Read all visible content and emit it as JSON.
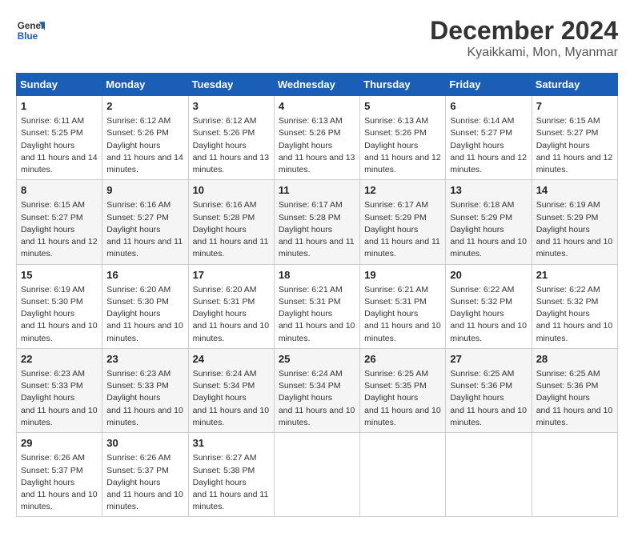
{
  "header": {
    "logo_general": "General",
    "logo_blue": "Blue",
    "month_title": "December 2024",
    "location": "Kyaikkami, Mon, Myanmar"
  },
  "calendar": {
    "days_of_week": [
      "Sunday",
      "Monday",
      "Tuesday",
      "Wednesday",
      "Thursday",
      "Friday",
      "Saturday"
    ],
    "weeks": [
      [
        {
          "day": "1",
          "sunrise": "6:11 AM",
          "sunset": "5:25 PM",
          "daylight": "11 hours and 14 minutes."
        },
        {
          "day": "2",
          "sunrise": "6:12 AM",
          "sunset": "5:26 PM",
          "daylight": "11 hours and 14 minutes."
        },
        {
          "day": "3",
          "sunrise": "6:12 AM",
          "sunset": "5:26 PM",
          "daylight": "11 hours and 13 minutes."
        },
        {
          "day": "4",
          "sunrise": "6:13 AM",
          "sunset": "5:26 PM",
          "daylight": "11 hours and 13 minutes."
        },
        {
          "day": "5",
          "sunrise": "6:13 AM",
          "sunset": "5:26 PM",
          "daylight": "11 hours and 12 minutes."
        },
        {
          "day": "6",
          "sunrise": "6:14 AM",
          "sunset": "5:27 PM",
          "daylight": "11 hours and 12 minutes."
        },
        {
          "day": "7",
          "sunrise": "6:15 AM",
          "sunset": "5:27 PM",
          "daylight": "11 hours and 12 minutes."
        }
      ],
      [
        {
          "day": "8",
          "sunrise": "6:15 AM",
          "sunset": "5:27 PM",
          "daylight": "11 hours and 12 minutes."
        },
        {
          "day": "9",
          "sunrise": "6:16 AM",
          "sunset": "5:27 PM",
          "daylight": "11 hours and 11 minutes."
        },
        {
          "day": "10",
          "sunrise": "6:16 AM",
          "sunset": "5:28 PM",
          "daylight": "11 hours and 11 minutes."
        },
        {
          "day": "11",
          "sunrise": "6:17 AM",
          "sunset": "5:28 PM",
          "daylight": "11 hours and 11 minutes."
        },
        {
          "day": "12",
          "sunrise": "6:17 AM",
          "sunset": "5:29 PM",
          "daylight": "11 hours and 11 minutes."
        },
        {
          "day": "13",
          "sunrise": "6:18 AM",
          "sunset": "5:29 PM",
          "daylight": "11 hours and 10 minutes."
        },
        {
          "day": "14",
          "sunrise": "6:19 AM",
          "sunset": "5:29 PM",
          "daylight": "11 hours and 10 minutes."
        }
      ],
      [
        {
          "day": "15",
          "sunrise": "6:19 AM",
          "sunset": "5:30 PM",
          "daylight": "11 hours and 10 minutes."
        },
        {
          "day": "16",
          "sunrise": "6:20 AM",
          "sunset": "5:30 PM",
          "daylight": "11 hours and 10 minutes."
        },
        {
          "day": "17",
          "sunrise": "6:20 AM",
          "sunset": "5:31 PM",
          "daylight": "11 hours and 10 minutes."
        },
        {
          "day": "18",
          "sunrise": "6:21 AM",
          "sunset": "5:31 PM",
          "daylight": "11 hours and 10 minutes."
        },
        {
          "day": "19",
          "sunrise": "6:21 AM",
          "sunset": "5:31 PM",
          "daylight": "11 hours and 10 minutes."
        },
        {
          "day": "20",
          "sunrise": "6:22 AM",
          "sunset": "5:32 PM",
          "daylight": "11 hours and 10 minutes."
        },
        {
          "day": "21",
          "sunrise": "6:22 AM",
          "sunset": "5:32 PM",
          "daylight": "11 hours and 10 minutes."
        }
      ],
      [
        {
          "day": "22",
          "sunrise": "6:23 AM",
          "sunset": "5:33 PM",
          "daylight": "11 hours and 10 minutes."
        },
        {
          "day": "23",
          "sunrise": "6:23 AM",
          "sunset": "5:33 PM",
          "daylight": "11 hours and 10 minutes."
        },
        {
          "day": "24",
          "sunrise": "6:24 AM",
          "sunset": "5:34 PM",
          "daylight": "11 hours and 10 minutes."
        },
        {
          "day": "25",
          "sunrise": "6:24 AM",
          "sunset": "5:34 PM",
          "daylight": "11 hours and 10 minutes."
        },
        {
          "day": "26",
          "sunrise": "6:25 AM",
          "sunset": "5:35 PM",
          "daylight": "11 hours and 10 minutes."
        },
        {
          "day": "27",
          "sunrise": "6:25 AM",
          "sunset": "5:36 PM",
          "daylight": "11 hours and 10 minutes."
        },
        {
          "day": "28",
          "sunrise": "6:25 AM",
          "sunset": "5:36 PM",
          "daylight": "11 hours and 10 minutes."
        }
      ],
      [
        {
          "day": "29",
          "sunrise": "6:26 AM",
          "sunset": "5:37 PM",
          "daylight": "11 hours and 10 minutes."
        },
        {
          "day": "30",
          "sunrise": "6:26 AM",
          "sunset": "5:37 PM",
          "daylight": "11 hours and 10 minutes."
        },
        {
          "day": "31",
          "sunrise": "6:27 AM",
          "sunset": "5:38 PM",
          "daylight": "11 hours and 11 minutes."
        },
        null,
        null,
        null,
        null
      ]
    ]
  }
}
